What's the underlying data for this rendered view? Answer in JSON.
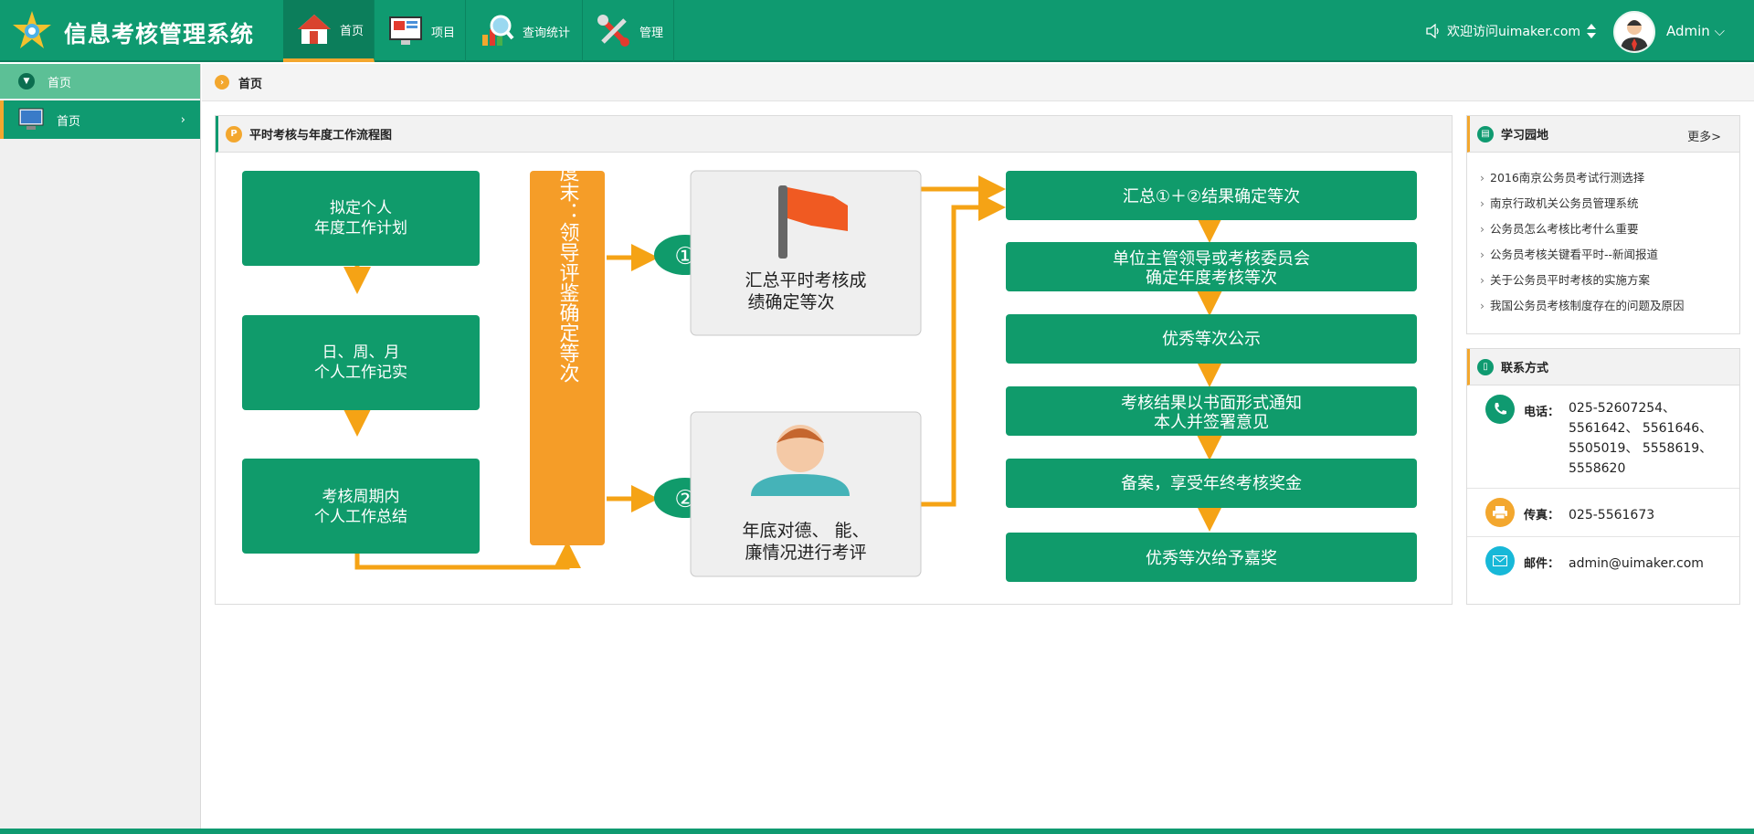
{
  "app": {
    "title": "信息考核管理系统"
  },
  "nav": [
    {
      "label": "首页"
    },
    {
      "label": "项目"
    },
    {
      "label": "查询统计"
    },
    {
      "label": "管理"
    }
  ],
  "header": {
    "welcome": "欢迎访问uimaker.com",
    "user": "Admin"
  },
  "sidebar": {
    "section": "首页",
    "item": "首页"
  },
  "breadcrumb": "首页",
  "flow": {
    "title": "平时考核与年度工作流程图",
    "left": [
      [
        "拟定个人",
        "年度工作计划"
      ],
      [
        "日、周、月",
        "个人工作记实"
      ],
      [
        "考核周期内",
        "个人工作总结"
      ]
    ],
    "vertical": "季度末：领导评鉴确定等次",
    "circle1": "①",
    "circle2": "②",
    "mid1": [
      "汇总平时考核成",
      "绩确定等次"
    ],
    "mid2": [
      "年底对德、 能、",
      "廉情况进行考评"
    ],
    "right": [
      [
        "汇总①＋②结果确定等次"
      ],
      [
        "单位主管领导或考核委员会",
        "确定年度考核等次"
      ],
      [
        "优秀等次公示"
      ],
      [
        "考核结果以书面形式通知",
        "本人并签署意见"
      ],
      [
        "备案，享受年终考核奖金"
      ],
      [
        "优秀等次给予嘉奖"
      ]
    ]
  },
  "learn": {
    "title": "学习园地",
    "more": "更多>",
    "items": [
      "2016南京公务员考试行测选择",
      "南京行政机关公务员管理系统",
      "公务员怎么考核比考什么重要",
      "公务员考核关键看平时--新闻报道",
      "关于公务员平时考核的实施方案",
      "我国公务员考核制度存在的问题及原因"
    ]
  },
  "contact": {
    "title": "联系方式",
    "phone_label": "电话：",
    "phone_lines": [
      "025-52607254、",
      "5561642、 5561646、",
      "5505019、 5558619、",
      "5558620"
    ],
    "fax_label": "传真：",
    "fax": "025-5561673",
    "email_label": "邮件：",
    "email": "admin@uimaker.com"
  },
  "colors": {
    "green": "#0f9a70",
    "orange": "#f3a72e",
    "light_green": "#5cc096"
  },
  "icons": {
    "logo": "star-logo-icon",
    "home": "house-icon",
    "project": "monitor-icon",
    "stats": "magnifier-chart-icon",
    "manage": "tools-icon"
  }
}
